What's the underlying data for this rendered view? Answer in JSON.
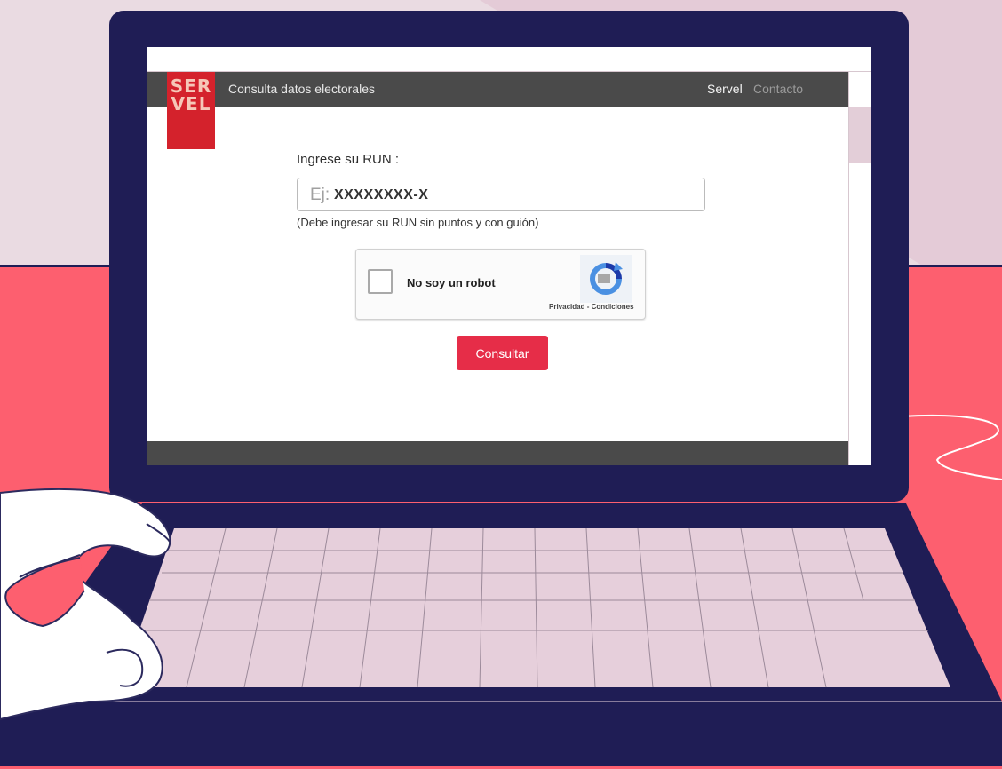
{
  "header": {
    "logo_line1": "SER",
    "logo_line2": "VEL",
    "title": "Consulta datos electorales",
    "nav": [
      "Servel",
      "Contacto"
    ]
  },
  "form": {
    "run_label": "Ingrese su RUN :",
    "input_prefix": "Ej:",
    "input_placeholder": "XXXXXXXX-X",
    "hint": "(Debe ingresar su RUN sin puntos y con guión)",
    "submit_label": "Consultar"
  },
  "captcha": {
    "label": "No soy un robot",
    "links": "Privacidad - Condiciones"
  },
  "colors": {
    "navbar": "#4a4a4a",
    "logo": "#d4222c",
    "button": "#e62d48",
    "laptop": "#1f1d55",
    "background": "#fd5f6f"
  }
}
